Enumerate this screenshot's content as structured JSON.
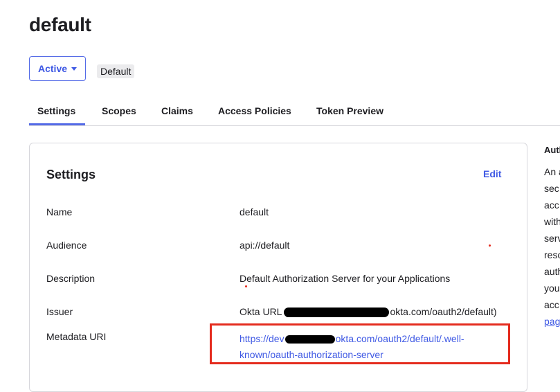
{
  "page": {
    "title": "default"
  },
  "status": {
    "label": "Active",
    "badge": "Default"
  },
  "tabs": [
    {
      "label": "Settings",
      "active": true
    },
    {
      "label": "Scopes"
    },
    {
      "label": "Claims"
    },
    {
      "label": "Access Policies"
    },
    {
      "label": "Token Preview"
    }
  ],
  "settings": {
    "title": "Settings",
    "edit_label": "Edit",
    "fields": [
      {
        "label": "Name",
        "value": "default"
      },
      {
        "label": "Audience",
        "value": "api://default"
      },
      {
        "label": "Description",
        "value": "Default Authorization Server for your Applications"
      },
      {
        "label": "Issuer",
        "value_prefix": "Okta URL (",
        "value_suffix": "okta.com/oauth2/default)"
      },
      {
        "label": "Metadata URI",
        "link_start": "https://dev",
        "link_end": "okta.com/oauth2/default/.well-",
        "link_line2": "known/oauth-authorization-server"
      }
    ]
  },
  "sidebar": {
    "title": "Autl",
    "lines": [
      "An a",
      "sec",
      "acc",
      "with",
      "serv",
      "reso",
      "auth",
      "you",
      "acc"
    ],
    "link": "pag"
  },
  "colors": {
    "accent": "#546be7",
    "annotation": "#e42b1e"
  }
}
